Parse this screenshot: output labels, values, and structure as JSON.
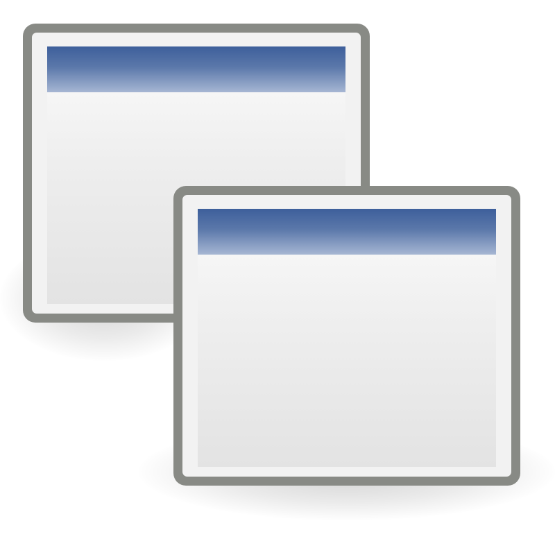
{
  "icon": {
    "name": "multiple-windows-icon",
    "windows": [
      {
        "name": "back-window"
      },
      {
        "name": "front-window"
      }
    ]
  },
  "colors": {
    "frame": "#888a85",
    "inner_frame": "#f2f2f2",
    "titlebar_top": "#3d5f9b",
    "titlebar_bottom": "#a6b6d3",
    "body_light": "#fbfbfb",
    "body_dark": "#e3e3e3"
  }
}
